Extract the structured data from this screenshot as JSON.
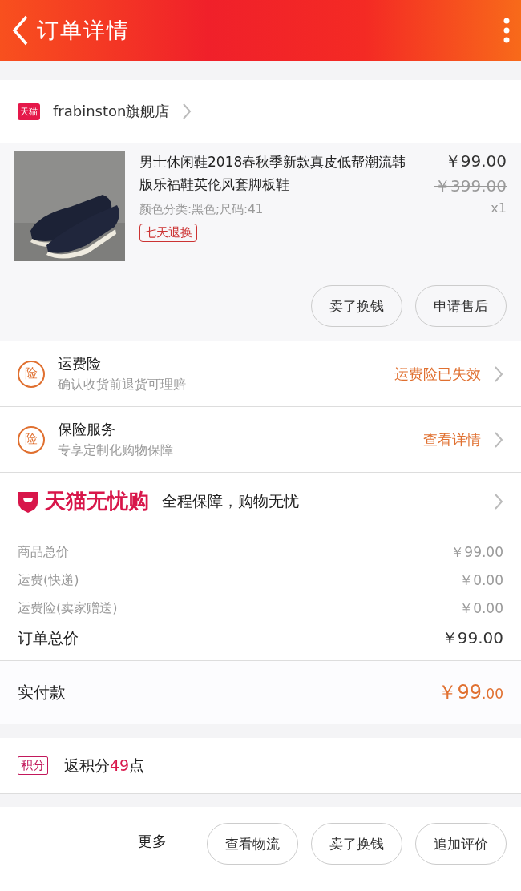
{
  "header": {
    "title": "订单详情"
  },
  "store": {
    "badge": "天猫",
    "name": "frabinston旗舰店"
  },
  "product": {
    "kind": "picture",
    "title": "男士休闲鞋2018春秋季新款真皮低帮潮流韩版乐福鞋英伦风套脚板鞋",
    "sku": "颜色分类:黑色;尺码:41",
    "tag": "七天退换",
    "price": "￥99.00",
    "original_price": "￥399.00",
    "quantity": "x1",
    "actions": [
      "卖了换钱",
      "申请售后"
    ]
  },
  "services": [
    {
      "icon": "险",
      "title": "运费险",
      "subtitle": "确认收货前退货可理赔",
      "action": "运费险已失效"
    },
    {
      "icon": "险",
      "title": "保险服务",
      "subtitle": "专享定制化购物保障",
      "action": "查看详情"
    }
  ],
  "guarantee": {
    "brand": "天猫无忧购",
    "text": "全程保障，购物无忧"
  },
  "summary": [
    {
      "label": "商品总价",
      "value": "￥99.00",
      "kind": "minor"
    },
    {
      "label": "运费(快递)",
      "value": "￥0.00",
      "kind": "minor"
    },
    {
      "label": "运费险(卖家赠送)",
      "value": "￥0.00",
      "kind": "minor"
    },
    {
      "label": "订单总价",
      "value": "￥99.00",
      "kind": "total"
    }
  ],
  "payment": {
    "label": "实付款",
    "amount": "￥99",
    "decimals": ".00"
  },
  "points": {
    "badge": "积分",
    "prefix": "返积分",
    "value": "49",
    "suffix": "点"
  },
  "bottom_bar": {
    "more": "更多",
    "buttons": [
      "查看物流",
      "卖了换钱",
      "追加评价"
    ]
  }
}
